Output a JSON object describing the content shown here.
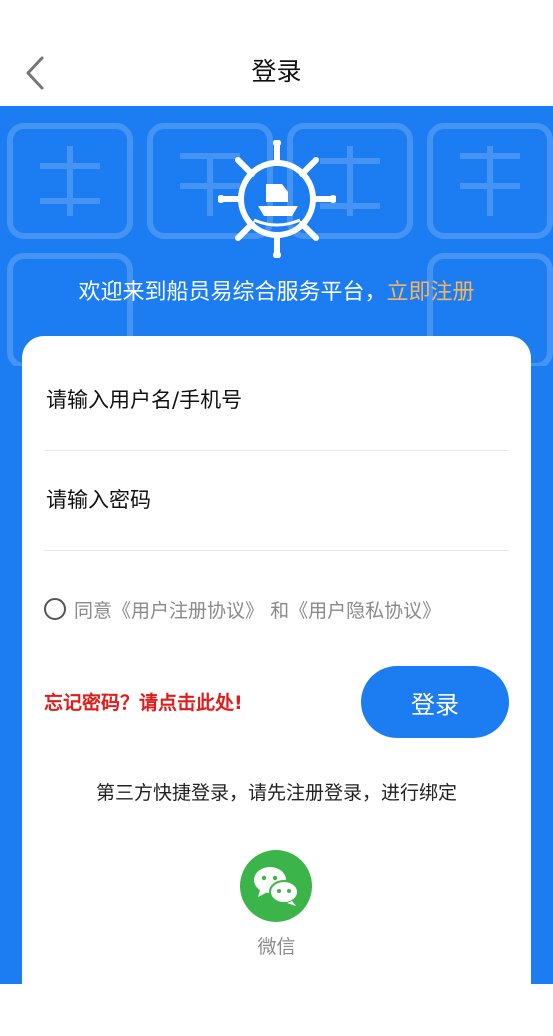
{
  "nav": {
    "title": "登录"
  },
  "hero": {
    "welcome_text": "欢迎来到船员易综合服务平台，",
    "register_link": "立即注册"
  },
  "form": {
    "username_placeholder": "请输入用户名/手机号",
    "password_placeholder": "请输入密码",
    "agree_prefix": "同意",
    "user_agreement": "《用户注册协议》",
    "and_text": "和",
    "privacy_agreement": "《用户隐私协议》",
    "forgot_password": "忘记密码？请点击此处!",
    "login_button": "登录"
  },
  "third_party": {
    "hint": "第三方快捷登录，请先注册登录，进行绑定",
    "wechat_label": "微信"
  },
  "colors": {
    "primary": "#1c7cf2",
    "register_link": "#f7b55b",
    "forgot": "#e21b1b",
    "wechat": "#3bb54a"
  }
}
